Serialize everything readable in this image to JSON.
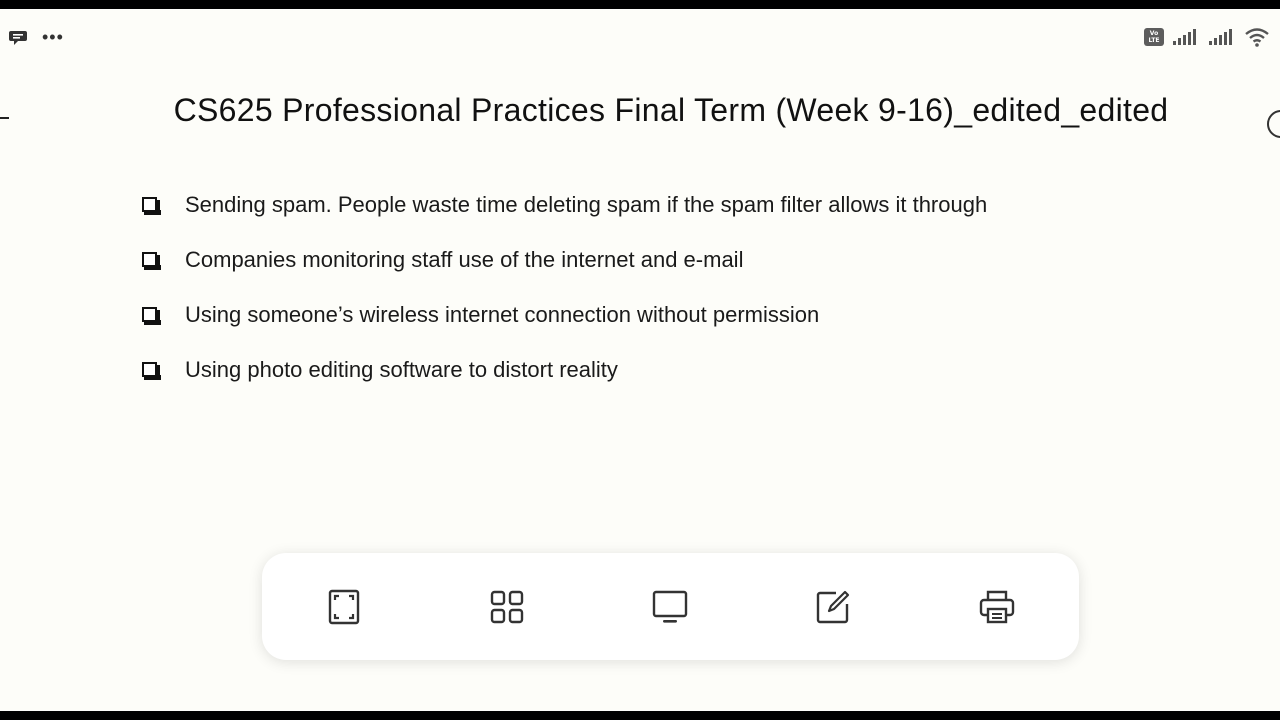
{
  "status_bar": {
    "left_icons": [
      "chat-bubble-icon",
      "more-dots-icon"
    ],
    "more_label": "•••",
    "right_icons": [
      "volte-icon",
      "signal-1-icon",
      "signal-2-icon",
      "wifi-icon"
    ],
    "volte_label_top": "Vo",
    "volte_label_bottom": "LTE"
  },
  "slide": {
    "title": "CS625 Professional Practices Final Term (Week 9-16)_edited_edited",
    "bullets": [
      "Sending spam. People waste time deleting spam if the spam filter allows it through",
      "Companies monitoring staff use of the internet and e-mail",
      "Using someone’s wireless internet connection without permission",
      "Using photo editing software to distort reality"
    ]
  },
  "toolbar": {
    "buttons": [
      "fullscreen-icon",
      "grid-view-icon",
      "present-icon",
      "edit-icon",
      "print-icon"
    ]
  },
  "colors": {
    "background": "#fdfdf9",
    "text": "#111111",
    "icon": "#333333"
  }
}
